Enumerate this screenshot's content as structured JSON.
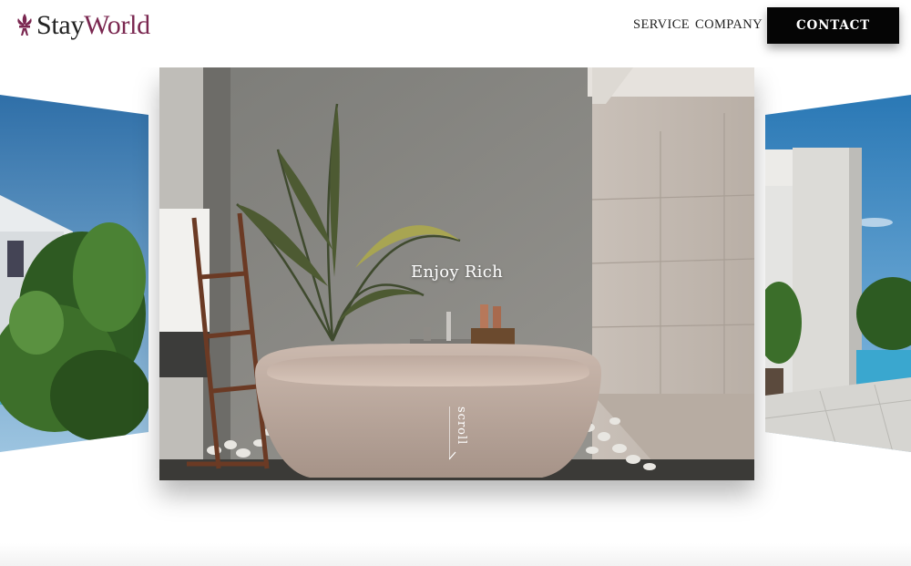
{
  "brand": {
    "name_part1": "Stay",
    "name_part2": "World",
    "logo_icon": "fleur-de-lis-icon",
    "accent_color": "#7a2750"
  },
  "nav": {
    "service": "SERVICE",
    "company": "COMPANY",
    "contact": "CONTACT"
  },
  "hero": {
    "caption": "Enjoy Rich",
    "scroll_label": "scroll",
    "slides": [
      {
        "name": "left-slide",
        "image": "poolside-building-with-plants"
      },
      {
        "name": "main-slide",
        "image": "stone-bathtub-with-palm"
      },
      {
        "name": "right-slide",
        "image": "poolside-white-pavilion"
      }
    ]
  },
  "colors": {
    "header_bg": "#ffffff",
    "button_bg": "#050505",
    "text": "#222222"
  }
}
